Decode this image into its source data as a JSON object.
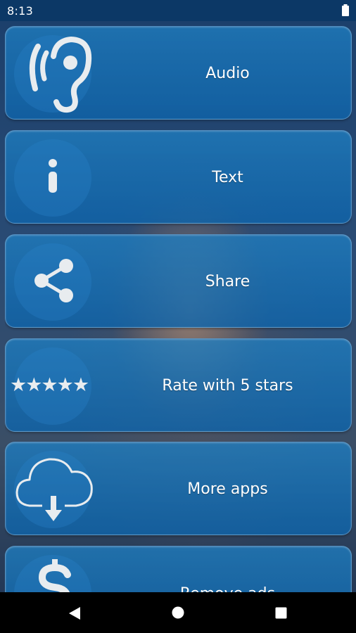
{
  "status_bar": {
    "time": "8:13",
    "battery_icon": "battery-full-icon"
  },
  "menu": {
    "items": [
      {
        "label": "Audio",
        "icon": "ear-hearing-icon"
      },
      {
        "label": "Text",
        "icon": "info-icon"
      },
      {
        "label": "Share",
        "icon": "share-icon"
      },
      {
        "label": "Rate with 5 stars",
        "icon": "five-stars-icon",
        "icon_text": "★★★★★"
      },
      {
        "label": "More apps",
        "icon": "cloud-download-icon"
      },
      {
        "label": "Remove ads",
        "icon": "dollar-icon"
      }
    ]
  },
  "nav_bar": {
    "back_icon": "back-triangle-icon",
    "home_icon": "home-circle-icon",
    "recents_icon": "recents-square-icon"
  },
  "colors": {
    "card": "#1a7cc0",
    "icon": "#e8ecef",
    "status_bar": "#0c3866",
    "nav_bar": "#000000"
  }
}
